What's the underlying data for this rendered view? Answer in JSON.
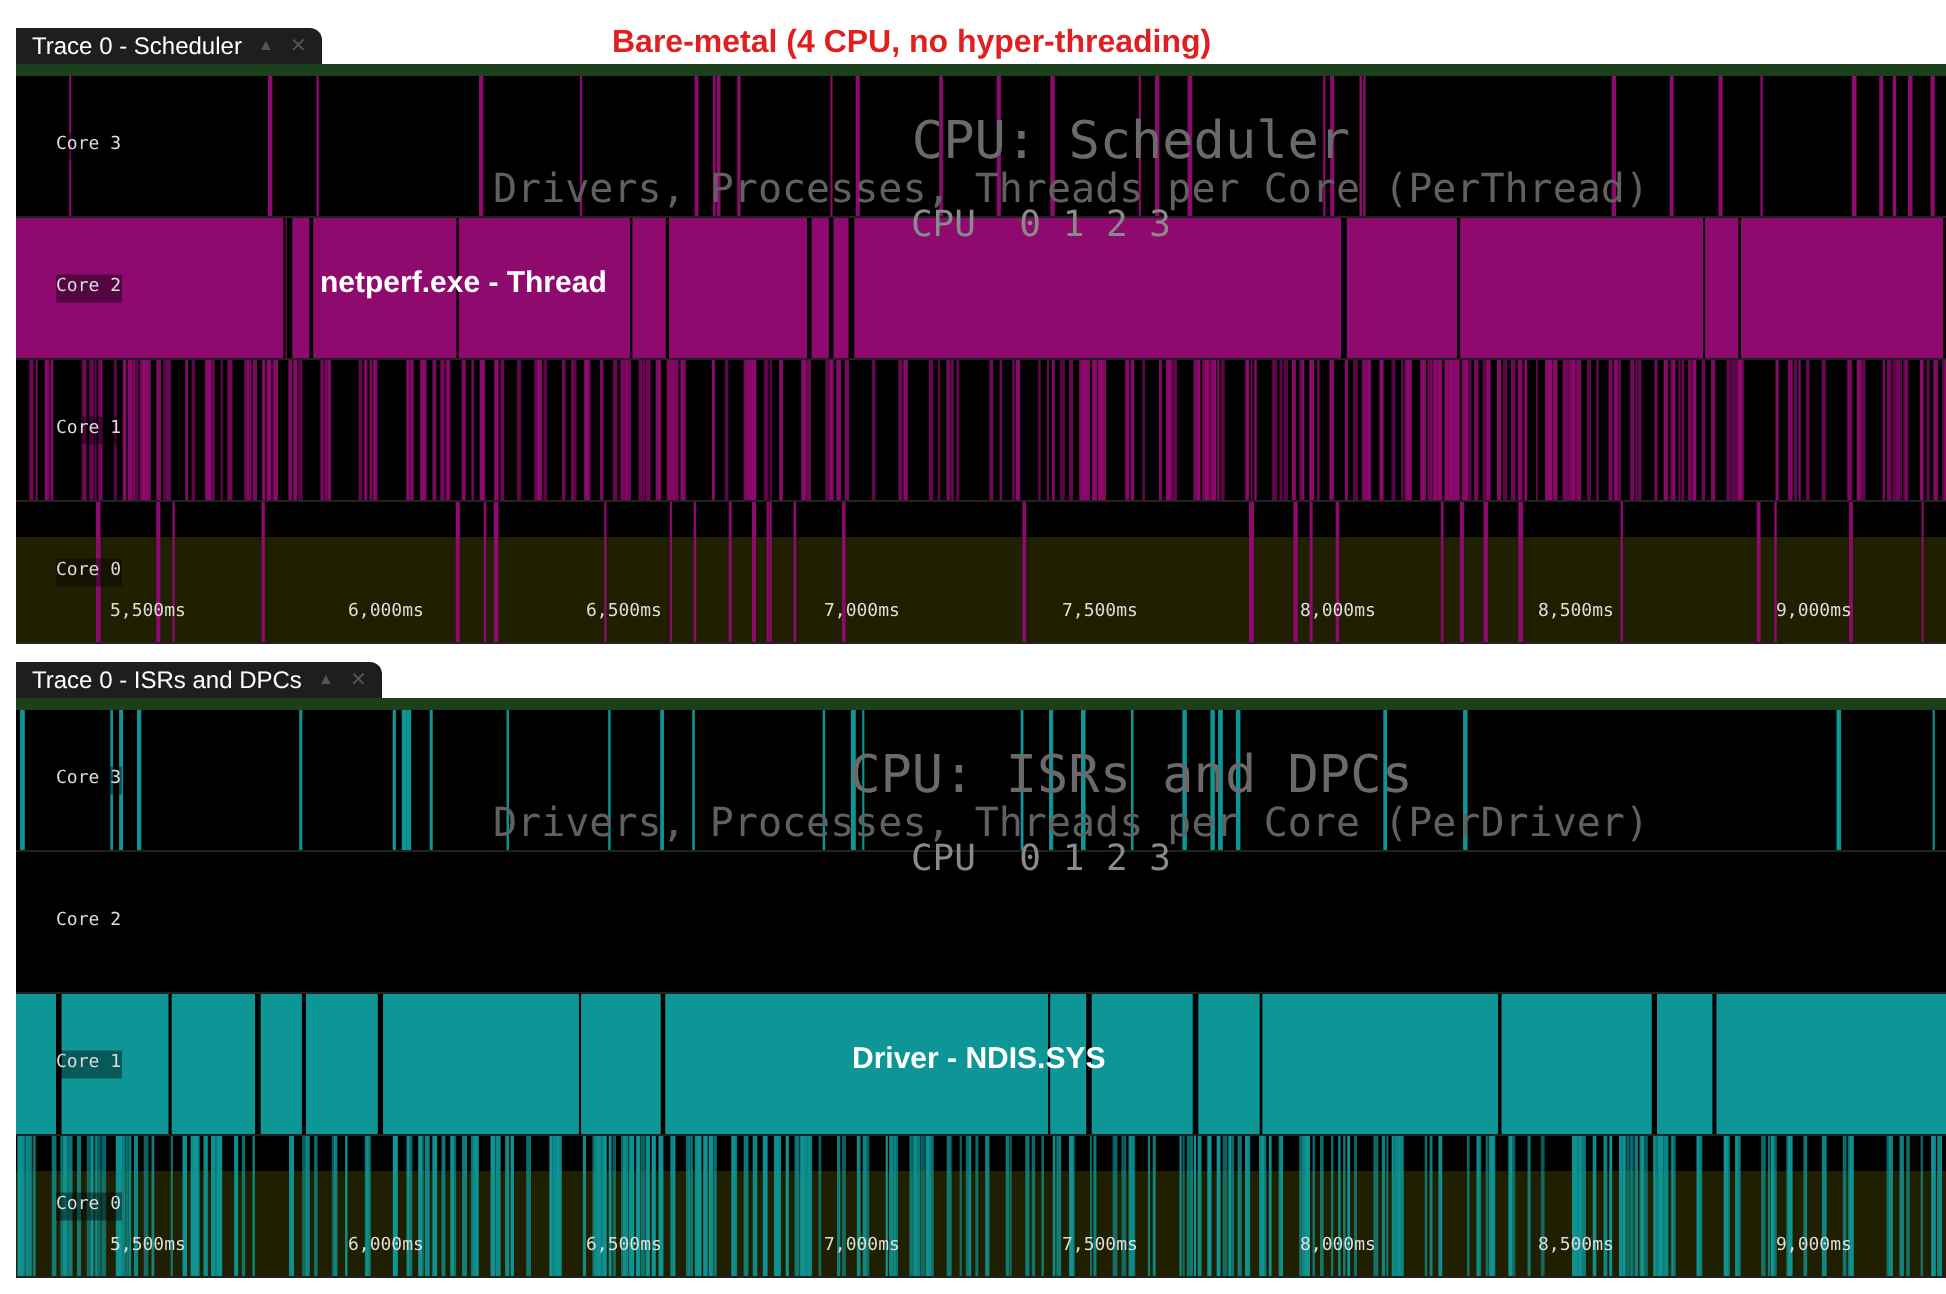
{
  "annotation": "Bare-metal (4 CPU, no hyper-threading)",
  "panels": [
    {
      "tab": {
        "title": "Trace 0 - Scheduler",
        "up": "▲",
        "close": "✕"
      },
      "title": "CPU: Scheduler",
      "subtitle": "Drivers, Processes, Threads per Core (PerThread)",
      "legend": "CPU  0 1 2 3",
      "color": "#8e0a6e",
      "lanes": [
        {
          "label": "Core 3",
          "kind": "sparse"
        },
        {
          "label": "Core 2",
          "kind": "full",
          "callout": "netperf.exe - Thread"
        },
        {
          "label": "Core 1",
          "kind": "dense"
        },
        {
          "label": "Core 0",
          "kind": "sparse"
        }
      ],
      "ticks": [
        "5,500ms",
        "6,000ms",
        "6,500ms",
        "7,000ms",
        "7,500ms",
        "8,000ms",
        "8,500ms",
        "9,000ms"
      ]
    },
    {
      "tab": {
        "title": "Trace 0 - ISRs and DPCs",
        "up": "▲",
        "close": "✕"
      },
      "title": "CPU: ISRs and DPCs",
      "subtitle": "Drivers, Processes, Threads per Core (PerDriver)",
      "legend": "CPU  0 1 2 3",
      "color": "#0e9696",
      "lanes": [
        {
          "label": "Core 3",
          "kind": "sparse"
        },
        {
          "label": "Core 2",
          "kind": "empty"
        },
        {
          "label": "Core 1",
          "kind": "full",
          "callout": "Driver - NDIS.SYS"
        },
        {
          "label": "Core 0",
          "kind": "dense"
        }
      ],
      "ticks": [
        "5,500ms",
        "6,000ms",
        "6,500ms",
        "7,000ms",
        "7,500ms",
        "8,000ms",
        "8,500ms",
        "9,000ms"
      ]
    }
  ]
}
